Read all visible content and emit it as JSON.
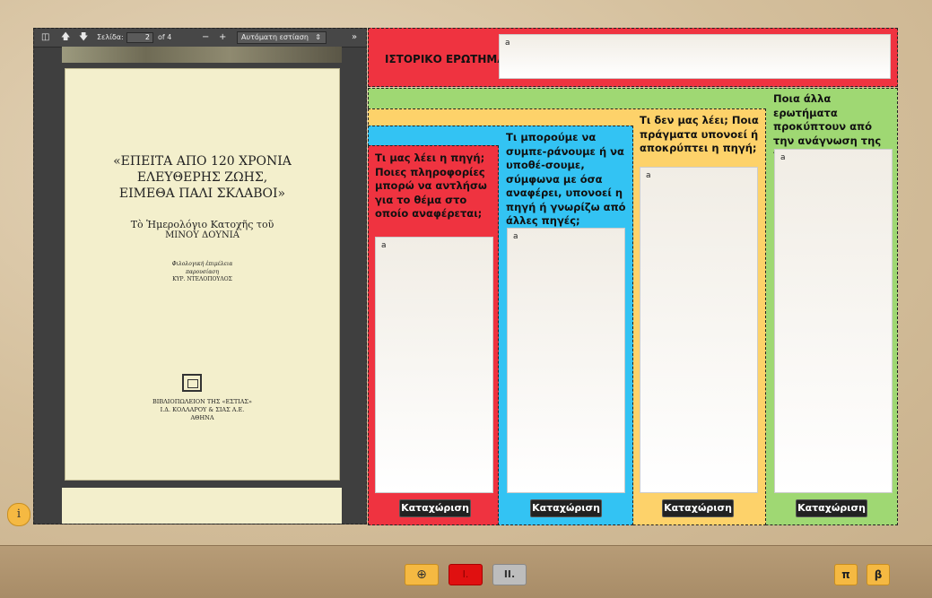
{
  "viewer": {
    "page_label": "Σελίδα:",
    "page_value": "2",
    "page_total": "of 4",
    "zoom_minus": "−",
    "zoom_plus": "+",
    "zoom_value": "Αυτόματη εστίαση",
    "more": "»",
    "book": {
      "title_line1": "«ΕΠΕΙΤΑ ΑΠΟ 120 ΧΡΟΝΙΑ",
      "title_line2": "ΕΛΕΥΘΕΡΗΣ ΖΩΗΣ,",
      "title_line3": "ΕΙΜΕΘΑ ΠΑΛΙ ΣΚΛΑΒΟΙ»",
      "subtitle_line1": "Τὸ Ἡμερολόγιο Κατοχῆς τοῦ",
      "subtitle_line2": "ΜΙΝΟΥ ΔΟΥΝΙΑ",
      "editor_line1": "Φιλολογική ἐπιμέλεια",
      "editor_line2": "παρουσίαση",
      "editor_line3": "ΚΥΡ. ΝΤΕΛΟΠΟΥΛΟΣ",
      "publisher_line1": "ΒΙΒΛΙΟΠΩΛΕΙΟΝ ΤΗΣ «ΕΣΤΙΑΣ»",
      "publisher_line2": "Ι.Δ. ΚΟΛΛΑΡΟΥ & ΣΙΑΣ Α.Ε.",
      "publisher_line3": "ΑΘΗΝΑ"
    }
  },
  "info_button": "i",
  "question": {
    "label": "ΙΣΤΟΡΙΚΟ ΕΡΩΤΗΜΑ:",
    "value": "a"
  },
  "columns": [
    {
      "label": "Τι μας λέει η πηγή; Ποιες πληροφορίες μπορώ να αντλήσω για το θέμα στο οποίο αναφέρεται;",
      "value": "a",
      "button": "Καταχώριση"
    },
    {
      "label": "Τι μπορούμε να συμπε-ράνουμε ή να υποθέ-σουμε, σύμφωνα με όσα αναφέρει, υπονοεί η πηγή ή γνωρίζω από άλλες πηγές;",
      "value": "a",
      "button": "Καταχώριση"
    },
    {
      "label": "Τι δεν μας λέει; Ποια πράγματα υπονοεί ή αποκρύπτει η πηγή;",
      "value": "a",
      "button": "Καταχώριση"
    },
    {
      "label": "Ποια άλλα ερωτήματα προκύπτουν από την ανάγνωση της πηγής;",
      "value": "a",
      "button": "Καταχώριση"
    }
  ],
  "bottom": {
    "btn_first": "⊕",
    "btn_second": "I.",
    "btn_third": "II.",
    "btn_pi": "π",
    "btn_beta": "β"
  },
  "colors": {
    "red": "#ef3340",
    "blue": "#33c3f3",
    "yellow": "#fdd26a",
    "green": "#9fd873"
  }
}
